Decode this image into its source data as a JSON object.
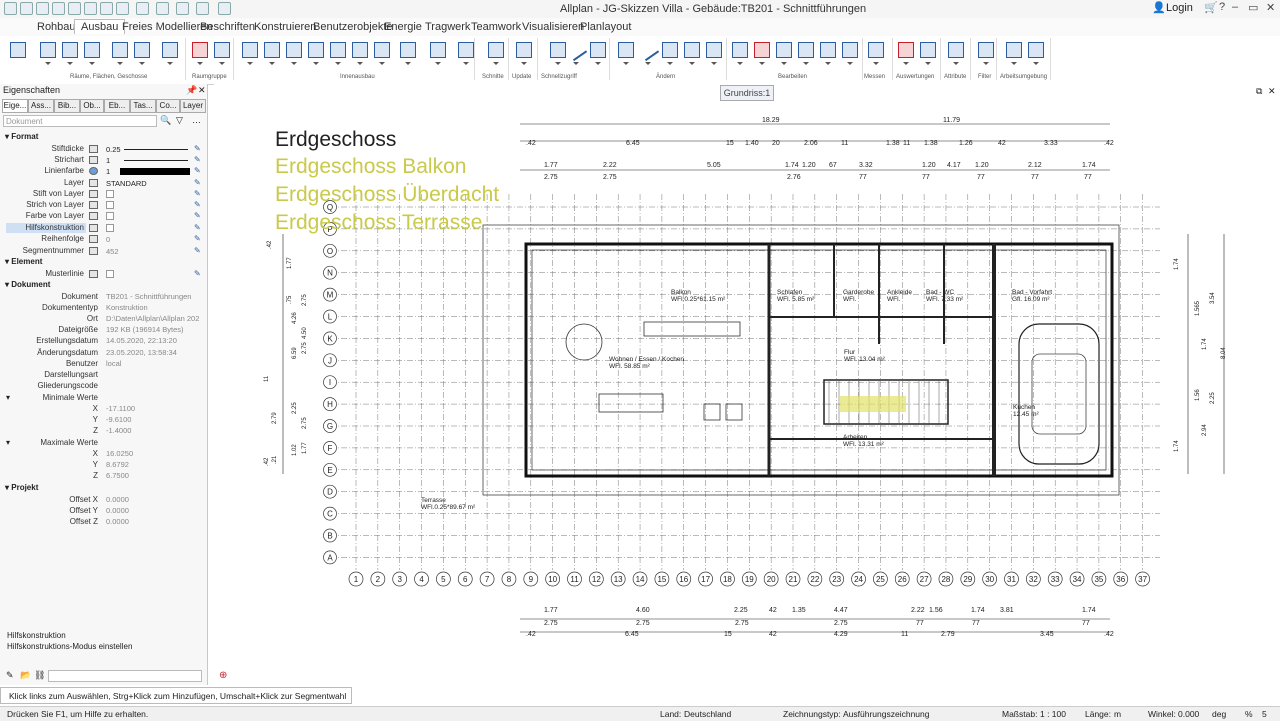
{
  "app": {
    "title": "Allplan - JG-Skizzen Villa - Gebäude:TB201 - Schnittführungen",
    "login": "Login"
  },
  "tabs": [
    "Rohbau",
    "Ausbau",
    "Freies Modellieren",
    "Beschriften",
    "Konstruieren",
    "Benutzerobjekte",
    "Energie",
    "Tragwerk",
    "Teamwork",
    "Visualisieren",
    "Planlayout"
  ],
  "active_tab": "Ausbau",
  "ribbon_groups": [
    "Räume, Flächen, Geschosse",
    "Raumgruppe",
    "Innenausbau",
    "Schnitte",
    "Update",
    "Schnellzugriff",
    "Ändern",
    "Bearbeiten",
    "Messen",
    "Auswertungen",
    "Attribute",
    "Filter",
    "Arbeitsumgebung"
  ],
  "panel": {
    "title": "Eigenschaften",
    "tabs": [
      "Eige...",
      "Ass...",
      "Bib...",
      "Ob...",
      "Eb...",
      "Tas...",
      "Co...",
      "Layer"
    ],
    "filter_placeholder": "Dokument",
    "sections": {
      "format": "Format",
      "element": "Element",
      "document": "Dokument",
      "project": "Projekt"
    },
    "format": {
      "stiftdicke_label": "Stiftdicke",
      "stiftdicke": "0.25",
      "strichart_label": "Strichart",
      "strichart": "1",
      "linienfarbe_label": "Linienfarbe",
      "linienfarbe": "1",
      "layer_label": "Layer",
      "layer": "STANDARD",
      "stift_layer": "Stift von Layer",
      "strich_layer": "Strich von Layer",
      "farbe_layer": "Farbe von Layer",
      "hilfskonstruktion": "Hilfskonstruktion",
      "reihenfolge_label": "Reihenfolge",
      "reihenfolge": "0",
      "segmentnummer_label": "Segmentnummer",
      "segmentnummer": "452"
    },
    "element": {
      "musterlinie": "Musterlinie"
    },
    "document": {
      "dokument_label": "Dokument",
      "dokument": "TB201 - Schnittführungen",
      "typ_label": "Dokumententyp",
      "typ": "Konstruktion",
      "ort_label": "Ort",
      "ort": "D:\\Daten\\Allplan\\Allplan 202",
      "groesse_label": "Dateigröße",
      "groesse": "192 KB (196914 Bytes)",
      "erstellt_label": "Erstellungsdatum",
      "erstellt": "14.05.2020, 22:13:20",
      "geaendert_label": "Änderungsdatum",
      "geaendert": "23.05.2020, 13:58:34",
      "benutzer_label": "Benutzer",
      "benutzer": "local",
      "darstellungsart": "Darstellungsart",
      "gliederungscode": "Gliederungscode",
      "min_label": "Minimale Werte",
      "min_x": "-17.1100",
      "min_y": "-9.6100",
      "min_z": "-1.4000",
      "max_label": "Maximale Werte",
      "max_x": "16.0250",
      "max_y": "8.6792",
      "max_z": "6.7500"
    },
    "project": {
      "ox": "0.0000",
      "oy": "0.0000",
      "oz": "0.0000",
      "ox_label": "Offset X",
      "oy_label": "Offset Y",
      "oz_label": "Offset Z"
    },
    "axis": {
      "x": "X",
      "y": "Y",
      "z": "Z"
    },
    "help_title": "Hilfskonstruktion",
    "help_text": "Hilfskonstruktions-Modus einstellen"
  },
  "canvas": {
    "view_tab": "Grundriss:1",
    "legend": [
      "Erdgeschoss",
      "Erdgeschoss Balkon",
      "Erdgeschoss Überdacht",
      "Erdgeschoss Terrasse"
    ],
    "legend_colors": [
      "#222222",
      "#c9c94a",
      "#c9c94a",
      "#c9c94a"
    ],
    "row_labels": [
      "Q",
      "P",
      "O",
      "N",
      "M",
      "L",
      "K",
      "J",
      "I",
      "H",
      "G",
      "F",
      "E",
      "D",
      "C",
      "B",
      "A"
    ],
    "col_labels": [
      "1",
      "2",
      "3",
      "4",
      "5",
      "6",
      "7",
      "8",
      "9",
      "10",
      "11",
      "12",
      "13",
      "14",
      "15",
      "16",
      "17",
      "18",
      "19",
      "20",
      "21",
      "22",
      "23",
      "24",
      "25",
      "26",
      "27",
      "28",
      "29",
      "30",
      "31",
      "32",
      "33",
      "34",
      "35",
      "36",
      "37"
    ],
    "dims_top1": [
      "18.29",
      "11.79"
    ],
    "dims_top2": [
      ".42",
      "6.45",
      "15",
      "1.40",
      "20",
      "2.06",
      "11",
      "1.38",
      "11",
      "1.38",
      "1.26",
      "42",
      "3.33",
      ".42"
    ],
    "dims_top3": [
      "1.77",
      "2.22",
      "5.05",
      "1.74",
      "1.20",
      "67",
      "3.32",
      "1.20",
      "4.17",
      "1.20",
      "2.12",
      "1.74"
    ],
    "dims_top4": [
      "2.75",
      "2.75",
      "2.76",
      "77",
      "77",
      "77",
      "77",
      "77"
    ],
    "dims_bot1": [
      "1.77",
      "4.60",
      "2.25",
      "42",
      "1.35",
      "4.47",
      "2.22",
      "1.56",
      "1.74",
      "3.81",
      "1.74"
    ],
    "dims_bot2": [
      "2.75",
      "2.75",
      "2.75",
      "2.75",
      "77",
      "77",
      "77"
    ],
    "dims_bot3": [
      ".42",
      "6.45",
      "15",
      "42",
      "4.29",
      "11",
      "2.79",
      "3.45",
      ".42"
    ],
    "rooms": [
      {
        "name": "Balkon",
        "area": "WFl.0.25*61.15 m²"
      },
      {
        "name": "Wohnen / Essen / Kochen",
        "area": "WFl. 58.85 m²"
      },
      {
        "name": "Schlafen",
        "area": "WFl. 5.85 m²"
      },
      {
        "name": "Garderobe",
        "area": "WFl."
      },
      {
        "name": "Ankleide",
        "area": "WFl."
      },
      {
        "name": "Bad - WC",
        "area": "WFl. 7.33 m²"
      },
      {
        "name": "Bad - Vorfahrt",
        "area": "Gfl. 16.09 m²"
      },
      {
        "name": "Flur",
        "area": "WFl. 13.04 m²"
      },
      {
        "name": "Kuchen",
        "area": "12.45 m²"
      },
      {
        "name": "Arbeiten",
        "area": "WFl. 13.31 m²"
      },
      {
        "name": "Terrasse",
        "area": "WFl.0.25*89.67 m²"
      }
    ],
    "left_dims": [
      ".42",
      "1.77",
      ".75",
      "2.75",
      "4.26",
      "4.50",
      "2.75",
      "6.59",
      "11",
      "2.25",
      "2.79",
      "2.75",
      "1.02",
      "1.77",
      ".21",
      ".42"
    ],
    "right_dims": [
      "1.74",
      "1.74",
      "1.565",
      "1.56",
      "1.74",
      "2.94",
      "3.54",
      "2.25",
      "8.04"
    ]
  },
  "hint": "Klick links zum Auswählen, Strg+Klick zum Hinzufügen, Umschalt+Klick zur Segmentwahl",
  "status": {
    "help": "Drücken Sie F1, um Hilfe zu erhalten.",
    "land_label": "Land:",
    "land": "Deutschland",
    "zeichnungstyp_label": "Zeichnungstyp:",
    "zeichnungstyp": "Ausführungszeichnung",
    "massstab_label": "Maßstab:",
    "massstab": "1 : 100",
    "laenge_label": "Länge:",
    "laenge": "m",
    "winkel_label": "Winkel:",
    "winkel": "0.000",
    "winkel_unit": "deg",
    "prozent": "%",
    "prozent_val": "5"
  }
}
